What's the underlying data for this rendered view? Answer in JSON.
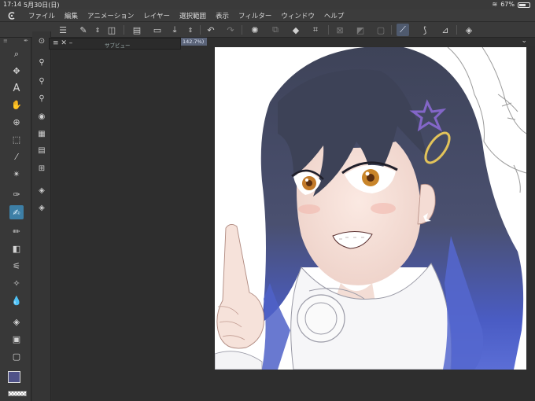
{
  "status": {
    "time": "17:14",
    "date": "5月30日(日)",
    "battery": "67%",
    "battery_level": 0.67
  },
  "menu": {
    "app_icon": "clip-studio-logo-icon",
    "items": [
      "ファイル",
      "編集",
      "アニメーション",
      "レイヤー",
      "選択範囲",
      "表示",
      "フィルター",
      "ウィンドウ",
      "ヘルプ"
    ]
  },
  "command_bar": {
    "icons": [
      "menu-icon",
      "new-icon",
      "stepper-icon",
      "settings-icon",
      "new-document-icon",
      "open-icon",
      "save-icon",
      "stepper-icon",
      "undo-icon",
      "redo-icon",
      "loading-icon",
      "fill-icon",
      "bucket-icon",
      "crop-icon",
      "clear-icon",
      "transparent-icon",
      "border-icon",
      "snap-ruler-icon",
      "snap-special-icon",
      "snap-grid-icon",
      "quick-access-icon"
    ]
  },
  "document_tab": {
    "label": "142.7%)"
  },
  "subview": {
    "title": "サブビュー",
    "controls": "≡ ✕ –"
  },
  "toolbar": {
    "tools": [
      "zoom-icon",
      "move-icon",
      "text-icon",
      "hand-icon",
      "auto-select-icon",
      "selection-icon",
      "eyedropper-icon",
      "sparkle-icon",
      "pen-icon",
      "brush-icon",
      "pencil-icon",
      "eraser-icon",
      "decorate-icon",
      "blend-icon",
      "fill-icon",
      "gradient-icon",
      "frame-icon"
    ],
    "active_tool": "brush-icon",
    "main_color": "#4f5288",
    "sub_color": "#ffffff"
  },
  "substrip": {
    "icons": [
      "navigator-icon",
      "tool-property-icon",
      "brush-size-icon",
      "brush-shape-icon",
      "color-wheel-icon",
      "color-set-icon",
      "intermediate-color-icon",
      "material-icon",
      "layer-property-icon",
      "layer-icon"
    ]
  }
}
